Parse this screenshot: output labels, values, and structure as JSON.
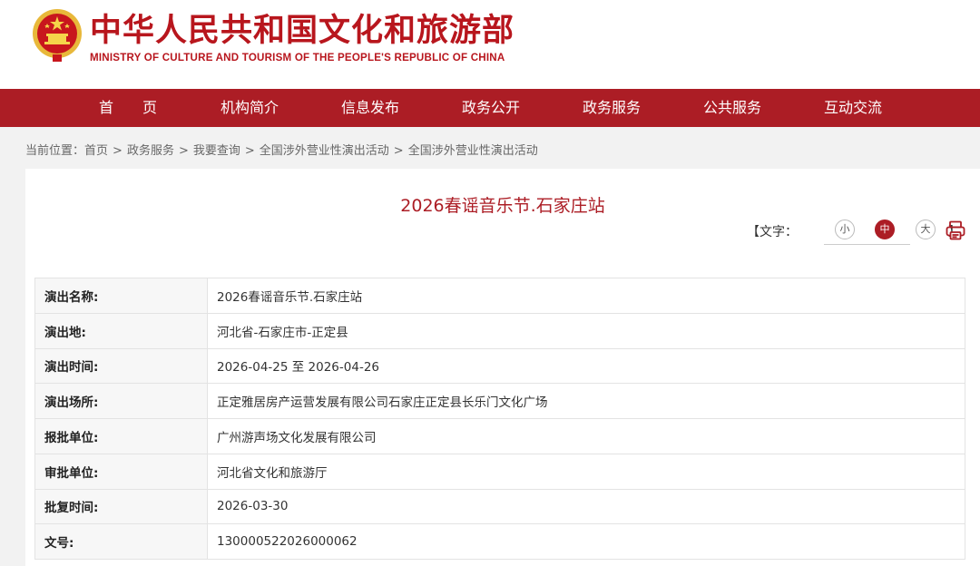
{
  "header": {
    "title_cn": "中华人民共和国文化和旅游部",
    "title_en": "MINISTRY OF CULTURE AND TOURISM OF THE PEOPLE'S REPUBLIC OF CHINA",
    "emblem_icon": "national-emblem-icon"
  },
  "nav": {
    "items": [
      {
        "label": "首　　页"
      },
      {
        "label": "机构简介"
      },
      {
        "label": "信息发布"
      },
      {
        "label": "政务公开"
      },
      {
        "label": "政务服务"
      },
      {
        "label": "公共服务"
      },
      {
        "label": "互动交流"
      }
    ]
  },
  "breadcrumb": {
    "prefix": "当前位置：",
    "items": [
      "首页",
      "政务服务",
      "我要查询",
      "全国涉外营业性演出活动",
      "全国涉外营业性演出活动"
    ],
    "separator": ">"
  },
  "article": {
    "title": "2026春谣音乐节.石家庄站"
  },
  "font_size": {
    "open_label": "【文字：",
    "close_label": "】",
    "small": "小",
    "medium": "中",
    "large": "大",
    "selected": "中"
  },
  "print_icon": "printer-icon",
  "table": {
    "rows": [
      {
        "label": "演出名称:",
        "value": "2026春谣音乐节.石家庄站"
      },
      {
        "label": "演出地:",
        "value": "河北省-石家庄市-正定县"
      },
      {
        "label": "演出时间:",
        "value": "2026-04-25 至 2026-04-26"
      },
      {
        "label": "演出场所:",
        "value": "正定雅居房产运营发展有限公司石家庄正定县长乐门文化广场"
      },
      {
        "label": "报批单位:",
        "value": "广州游声场文化发展有限公司"
      },
      {
        "label": "审批单位:",
        "value": "河北省文化和旅游厅"
      },
      {
        "label": "批复时间:",
        "value": "2026-03-30"
      },
      {
        "label": "文号:",
        "value": "130000522026000062"
      }
    ]
  },
  "colors": {
    "brand_red": "#ac1d25",
    "logo_red": "#b8161d",
    "emblem_gold": "#e8b83a"
  }
}
